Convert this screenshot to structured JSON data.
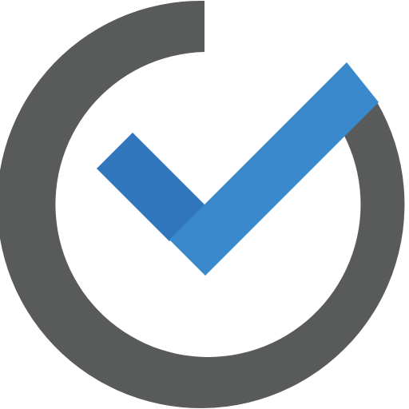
{
  "icon": {
    "name": "checkmark-progress-circle-icon",
    "ring_color": "#595b5b",
    "check_color": "#3a89cc",
    "check_shadow_color": "#2f76bd",
    "background_color": "#ffffff"
  }
}
